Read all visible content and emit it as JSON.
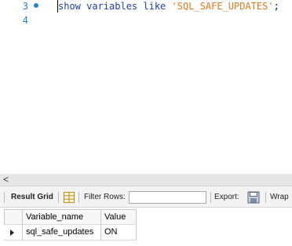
{
  "editor": {
    "lines": [
      {
        "number": "3",
        "tokens": {
          "kw": "show variables like",
          "str": "'SQL_SAFE_UPDATES'",
          "punc": ";"
        }
      },
      {
        "number": "4"
      }
    ]
  },
  "scrollbar": {
    "left_arrow": "<"
  },
  "toolbar": {
    "result_grid_label": "Result Grid",
    "filter_rows_label": "Filter Rows:",
    "filter_rows_value": "",
    "export_label": "Export:",
    "wrap_label": "Wrap"
  },
  "results": {
    "columns": [
      "Variable_name",
      "Value"
    ],
    "rows": [
      [
        "sql_safe_updates",
        "ON"
      ]
    ]
  },
  "colors": {
    "line_number": "#2a83c9",
    "keyword": "#1f3fae",
    "string": "#e07a1f"
  }
}
